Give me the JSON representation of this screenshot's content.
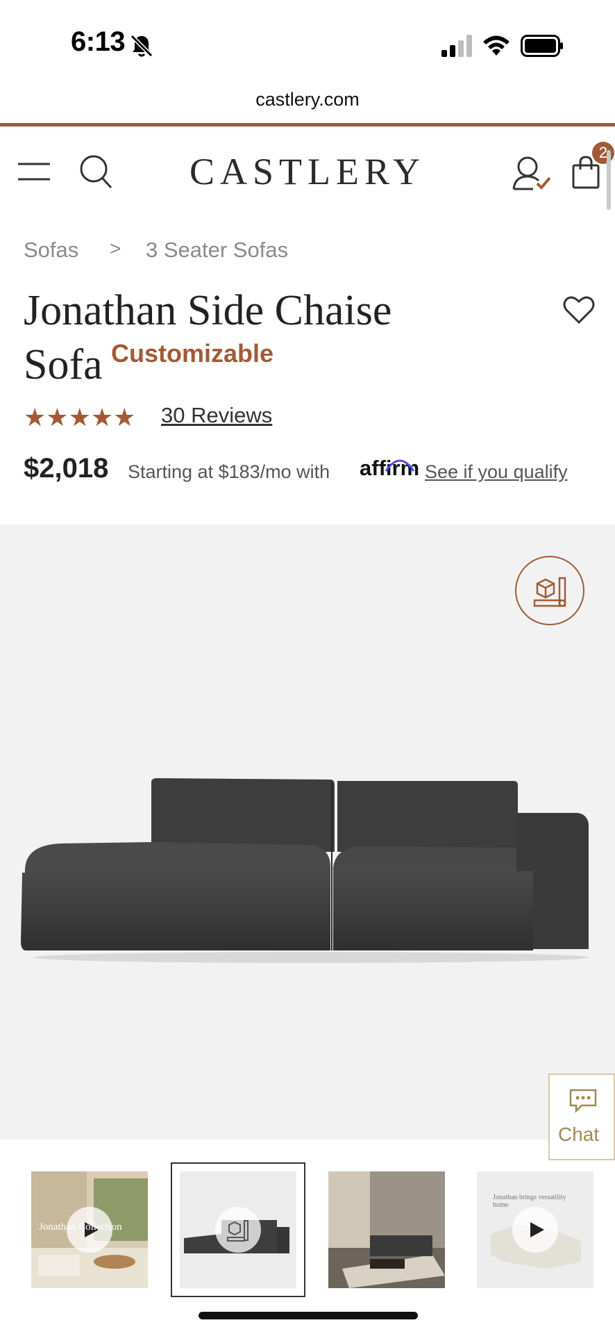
{
  "status_bar": {
    "time": "6:13"
  },
  "browser": {
    "url": "castlery.com"
  },
  "header": {
    "logo": "CASTLERY",
    "cart_count": "2"
  },
  "breadcrumb": {
    "items": [
      "Sofas",
      "3 Seater Sofas"
    ],
    "separator": ">"
  },
  "product": {
    "title_line1": "Jonathan Side Chaise",
    "title_line2": "Sofa",
    "badge": "Customizable",
    "rating_stars": 5,
    "reviews_label": "30 Reviews",
    "price": "$2,018",
    "financing_text": "Starting at $183/mo with",
    "financing_brand": "affirm",
    "financing_link": "See if you qualify"
  },
  "chat": {
    "label": "Chat"
  },
  "thumbnails": [
    {
      "caption": "Jonathan Collection",
      "has_play": true
    },
    {
      "caption": "",
      "has_play": false,
      "selected": true
    },
    {
      "caption": "",
      "has_play": false
    },
    {
      "caption": "Jonathan brings versatility home",
      "has_play": true
    }
  ],
  "colors": {
    "accent": "#a25a36",
    "chat_accent": "#a08a50",
    "image_bg": "#f2f2f2"
  }
}
